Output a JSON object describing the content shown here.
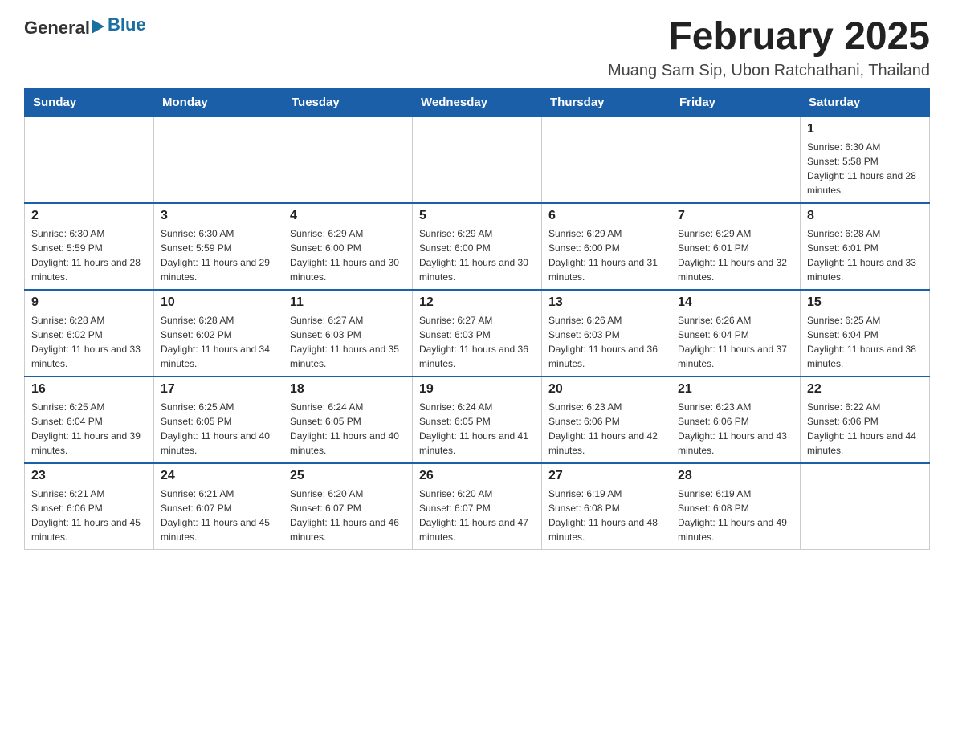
{
  "logo": {
    "general": "General",
    "blue": "Blue"
  },
  "title": "February 2025",
  "location": "Muang Sam Sip, Ubon Ratchathani, Thailand",
  "days_of_week": [
    "Sunday",
    "Monday",
    "Tuesday",
    "Wednesday",
    "Thursday",
    "Friday",
    "Saturday"
  ],
  "weeks": [
    [
      {
        "day": "",
        "info": ""
      },
      {
        "day": "",
        "info": ""
      },
      {
        "day": "",
        "info": ""
      },
      {
        "day": "",
        "info": ""
      },
      {
        "day": "",
        "info": ""
      },
      {
        "day": "",
        "info": ""
      },
      {
        "day": "1",
        "info": "Sunrise: 6:30 AM\nSunset: 5:58 PM\nDaylight: 11 hours and 28 minutes."
      }
    ],
    [
      {
        "day": "2",
        "info": "Sunrise: 6:30 AM\nSunset: 5:59 PM\nDaylight: 11 hours and 28 minutes."
      },
      {
        "day": "3",
        "info": "Sunrise: 6:30 AM\nSunset: 5:59 PM\nDaylight: 11 hours and 29 minutes."
      },
      {
        "day": "4",
        "info": "Sunrise: 6:29 AM\nSunset: 6:00 PM\nDaylight: 11 hours and 30 minutes."
      },
      {
        "day": "5",
        "info": "Sunrise: 6:29 AM\nSunset: 6:00 PM\nDaylight: 11 hours and 30 minutes."
      },
      {
        "day": "6",
        "info": "Sunrise: 6:29 AM\nSunset: 6:00 PM\nDaylight: 11 hours and 31 minutes."
      },
      {
        "day": "7",
        "info": "Sunrise: 6:29 AM\nSunset: 6:01 PM\nDaylight: 11 hours and 32 minutes."
      },
      {
        "day": "8",
        "info": "Sunrise: 6:28 AM\nSunset: 6:01 PM\nDaylight: 11 hours and 33 minutes."
      }
    ],
    [
      {
        "day": "9",
        "info": "Sunrise: 6:28 AM\nSunset: 6:02 PM\nDaylight: 11 hours and 33 minutes."
      },
      {
        "day": "10",
        "info": "Sunrise: 6:28 AM\nSunset: 6:02 PM\nDaylight: 11 hours and 34 minutes."
      },
      {
        "day": "11",
        "info": "Sunrise: 6:27 AM\nSunset: 6:03 PM\nDaylight: 11 hours and 35 minutes."
      },
      {
        "day": "12",
        "info": "Sunrise: 6:27 AM\nSunset: 6:03 PM\nDaylight: 11 hours and 36 minutes."
      },
      {
        "day": "13",
        "info": "Sunrise: 6:26 AM\nSunset: 6:03 PM\nDaylight: 11 hours and 36 minutes."
      },
      {
        "day": "14",
        "info": "Sunrise: 6:26 AM\nSunset: 6:04 PM\nDaylight: 11 hours and 37 minutes."
      },
      {
        "day": "15",
        "info": "Sunrise: 6:25 AM\nSunset: 6:04 PM\nDaylight: 11 hours and 38 minutes."
      }
    ],
    [
      {
        "day": "16",
        "info": "Sunrise: 6:25 AM\nSunset: 6:04 PM\nDaylight: 11 hours and 39 minutes."
      },
      {
        "day": "17",
        "info": "Sunrise: 6:25 AM\nSunset: 6:05 PM\nDaylight: 11 hours and 40 minutes."
      },
      {
        "day": "18",
        "info": "Sunrise: 6:24 AM\nSunset: 6:05 PM\nDaylight: 11 hours and 40 minutes."
      },
      {
        "day": "19",
        "info": "Sunrise: 6:24 AM\nSunset: 6:05 PM\nDaylight: 11 hours and 41 minutes."
      },
      {
        "day": "20",
        "info": "Sunrise: 6:23 AM\nSunset: 6:06 PM\nDaylight: 11 hours and 42 minutes."
      },
      {
        "day": "21",
        "info": "Sunrise: 6:23 AM\nSunset: 6:06 PM\nDaylight: 11 hours and 43 minutes."
      },
      {
        "day": "22",
        "info": "Sunrise: 6:22 AM\nSunset: 6:06 PM\nDaylight: 11 hours and 44 minutes."
      }
    ],
    [
      {
        "day": "23",
        "info": "Sunrise: 6:21 AM\nSunset: 6:06 PM\nDaylight: 11 hours and 45 minutes."
      },
      {
        "day": "24",
        "info": "Sunrise: 6:21 AM\nSunset: 6:07 PM\nDaylight: 11 hours and 45 minutes."
      },
      {
        "day": "25",
        "info": "Sunrise: 6:20 AM\nSunset: 6:07 PM\nDaylight: 11 hours and 46 minutes."
      },
      {
        "day": "26",
        "info": "Sunrise: 6:20 AM\nSunset: 6:07 PM\nDaylight: 11 hours and 47 minutes."
      },
      {
        "day": "27",
        "info": "Sunrise: 6:19 AM\nSunset: 6:08 PM\nDaylight: 11 hours and 48 minutes."
      },
      {
        "day": "28",
        "info": "Sunrise: 6:19 AM\nSunset: 6:08 PM\nDaylight: 11 hours and 49 minutes."
      },
      {
        "day": "",
        "info": ""
      }
    ]
  ]
}
